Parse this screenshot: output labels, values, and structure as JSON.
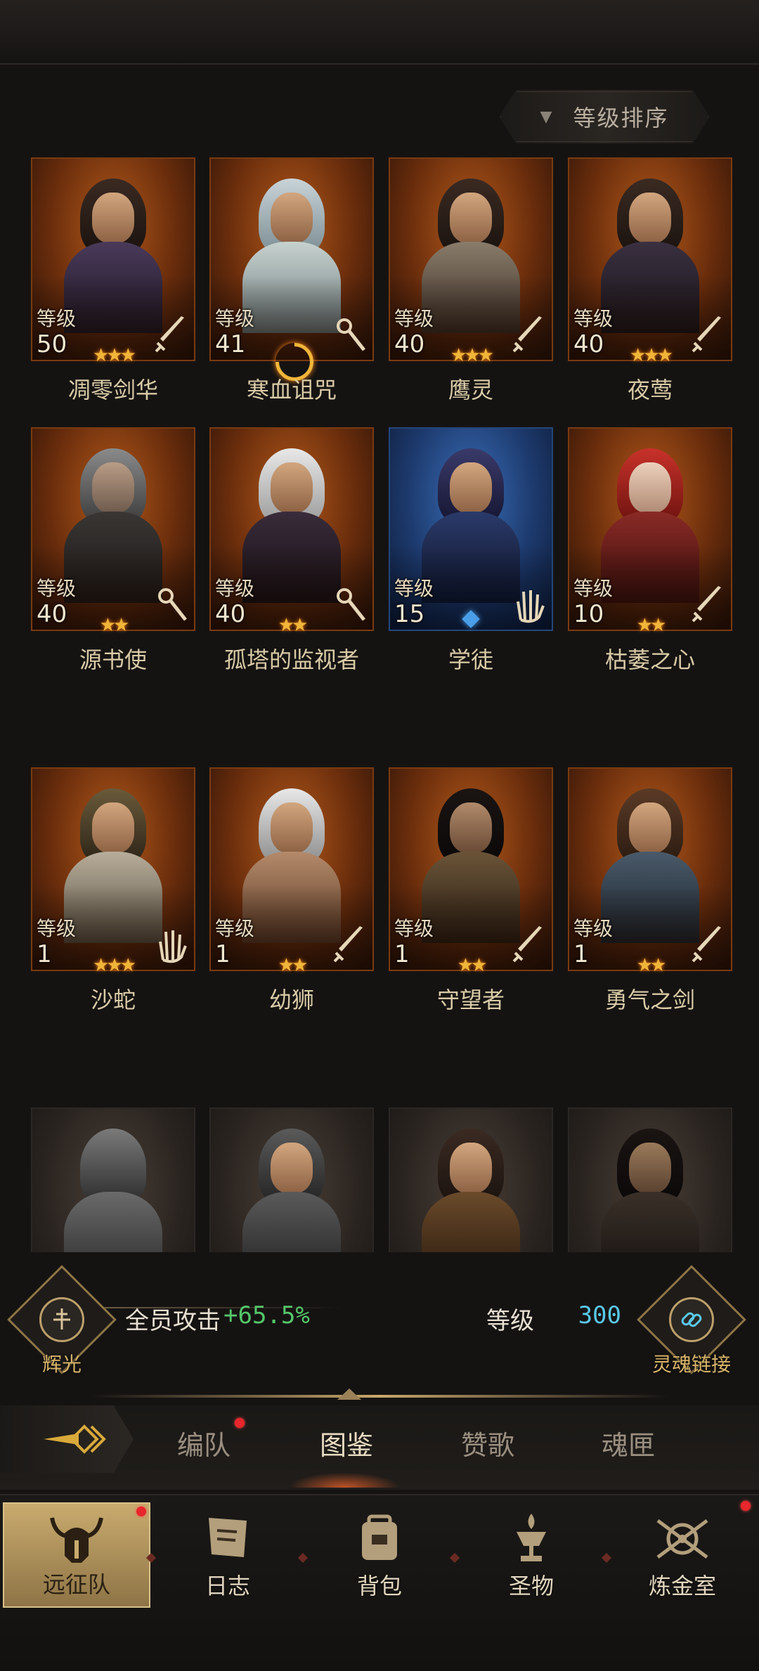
{
  "sort": {
    "label": "等级排序",
    "arrow_icon": "triangle-down-icon"
  },
  "heroes": [
    {
      "name": "凋零剑华",
      "level_label": "等级",
      "level": "50",
      "stars": "★★★",
      "weapon": "sword-icon",
      "rank_type": "stars",
      "frame": "orange"
    },
    {
      "name": "寒血诅咒",
      "level_label": "等级",
      "level": "41",
      "stars": "",
      "weapon": "staff-icon",
      "rank_type": "moon",
      "frame": "orange"
    },
    {
      "name": "鹰灵",
      "level_label": "等级",
      "level": "40",
      "stars": "★★★",
      "weapon": "sword-icon",
      "rank_type": "stars",
      "frame": "orange"
    },
    {
      "name": "夜莺",
      "level_label": "等级",
      "level": "40",
      "stars": "★★★",
      "weapon": "sword-icon",
      "rank_type": "stars",
      "frame": "orange"
    },
    {
      "name": "源书使",
      "level_label": "等级",
      "level": "40",
      "stars": "★★",
      "weapon": "staff-icon",
      "rank_type": "stars",
      "frame": "orange"
    },
    {
      "name": "孤塔的监视者",
      "level_label": "等级",
      "level": "40",
      "stars": "★★",
      "weapon": "staff-icon",
      "rank_type": "stars",
      "frame": "orange"
    },
    {
      "name": "学徒",
      "level_label": "等级",
      "level": "15",
      "stars": "",
      "weapon": "hand-icon",
      "rank_type": "diamond",
      "frame": "blue"
    },
    {
      "name": "枯萎之心",
      "level_label": "等级",
      "level": "10",
      "stars": "★★",
      "weapon": "sword-icon",
      "rank_type": "stars",
      "frame": "orange"
    },
    {
      "name": "沙蛇",
      "level_label": "等级",
      "level": "1",
      "stars": "★★★",
      "weapon": "hand-icon",
      "rank_type": "stars",
      "frame": "orange"
    },
    {
      "name": "幼狮",
      "level_label": "等级",
      "level": "1",
      "stars": "★★",
      "weapon": "sword-icon",
      "rank_type": "stars",
      "frame": "orange"
    },
    {
      "name": "守望者",
      "level_label": "等级",
      "level": "1",
      "stars": "★★",
      "weapon": "sword-icon",
      "rank_type": "stars",
      "frame": "orange"
    },
    {
      "name": "勇气之剑",
      "level_label": "等级",
      "level": "1",
      "stars": "★★",
      "weapon": "sword-icon",
      "rank_type": "stars",
      "frame": "orange"
    }
  ],
  "partial_heroes": [
    {
      "portrait": "armored-knight-portrait"
    },
    {
      "portrait": "helmeted-soldier-portrait"
    },
    {
      "portrait": "dark-haired-woman-portrait"
    },
    {
      "portrait": "bearded-warrior-portrait"
    }
  ],
  "bonus": {
    "left_emblem_label": "辉光",
    "attack_label": "全员攻击",
    "attack_value": "+65.5%",
    "level_label": "等级",
    "level_value": "300",
    "right_emblem_label": "灵魂链接"
  },
  "subtabs": [
    {
      "label": "编队",
      "badge": true,
      "active": false
    },
    {
      "label": "图鉴",
      "badge": false,
      "active": true
    },
    {
      "label": "赞歌",
      "badge": false,
      "active": false
    },
    {
      "label": "魂匣",
      "badge": false,
      "active": false
    }
  ],
  "bottom_nav": [
    {
      "label": "远征队",
      "icon": "horned-helmet-icon",
      "active": true,
      "badge": true
    },
    {
      "label": "日志",
      "icon": "scroll-icon",
      "active": false,
      "badge": false
    },
    {
      "label": "背包",
      "icon": "bag-icon",
      "active": false,
      "badge": false
    },
    {
      "label": "圣物",
      "icon": "chalice-icon",
      "active": false,
      "badge": false
    },
    {
      "label": "炼金室",
      "icon": "alchemy-icon",
      "active": false,
      "badge": true
    }
  ],
  "colors": {
    "accent_gold": "#d7b56b",
    "bonus_green": "#54c76a",
    "level_cyan": "#58c9e8",
    "badge_red": "#e8262b"
  }
}
